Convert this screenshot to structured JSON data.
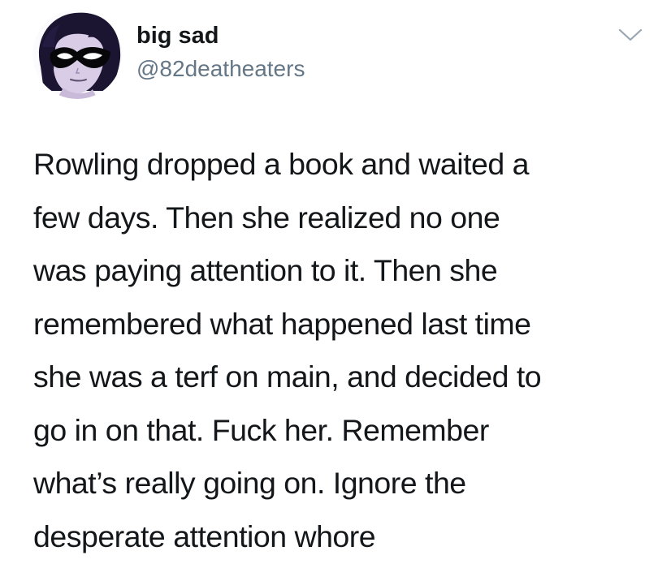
{
  "tweet": {
    "author": {
      "display_name": "big sad",
      "handle": "@82deatheaters",
      "avatar_icon": "masked-cartoon-character-avatar"
    },
    "menu_icon": "chevron-down-icon",
    "text": "Rowling dropped a book and waited a\nfew days. Then she realized no one\nwas paying attention to it. Then she\nremembered what happened last time\nshe was a terf on main, and decided to\ngo in on that. Fuck her. Remember\nwhat’s really going on. Ignore the\ndesperate attention whore"
  },
  "colors": {
    "text_primary": "#14171a",
    "text_secondary": "#657786",
    "background": "#ffffff",
    "avatar_background": "#fbfbfd",
    "avatar_hair": "#1b1531",
    "avatar_skin": "#d9cce7",
    "avatar_mask": "#07070a"
  }
}
